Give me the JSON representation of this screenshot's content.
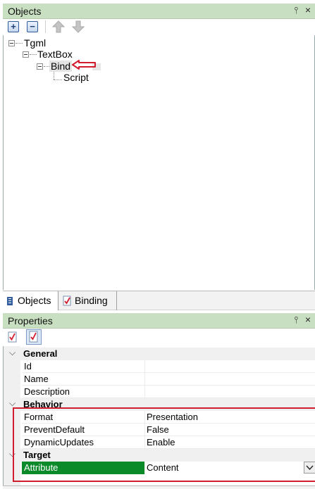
{
  "objects_panel": {
    "title": "Objects",
    "pin_glyph": "ᵦ",
    "close_glyph": "×",
    "toolbar": {
      "expand_label": "+",
      "collapse_label": "−"
    },
    "tree": [
      {
        "label": "Tgml"
      },
      {
        "label": "TextBox"
      },
      {
        "label": "Bind"
      },
      {
        "label": "Script"
      }
    ]
  },
  "tabs": [
    {
      "label": "Objects"
    },
    {
      "label": "Binding"
    }
  ],
  "properties_panel": {
    "title": "Properties",
    "pin_glyph": "ᵦ",
    "close_glyph": "×",
    "categories": [
      {
        "name": "General",
        "properties": [
          {
            "name": "Id",
            "value": ""
          },
          {
            "name": "Name",
            "value": ""
          },
          {
            "name": "Description",
            "value": ""
          }
        ]
      },
      {
        "name": "Behavior",
        "properties": [
          {
            "name": "Format",
            "value": "Presentation"
          },
          {
            "name": "PreventDefault",
            "value": "False"
          },
          {
            "name": "DynamicUpdates",
            "value": "Enable"
          }
        ]
      },
      {
        "name": "Target",
        "properties": [
          {
            "name": "Attribute",
            "value": "Content"
          }
        ]
      }
    ]
  },
  "colors": {
    "header_bg": "#c9dfc1",
    "selected_property_bg": "#0b8a2a",
    "annotation_red": "#d21c2f"
  }
}
